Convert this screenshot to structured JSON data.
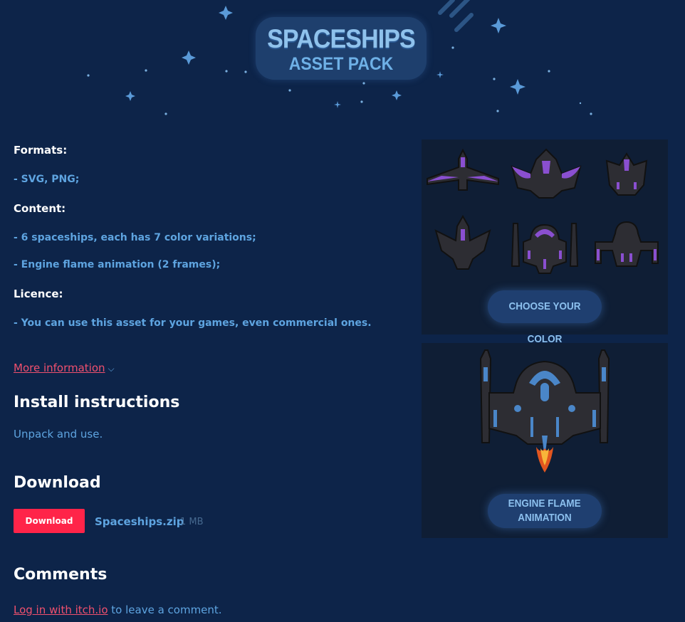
{
  "banner": {
    "line1": "SPACESHIPS",
    "line2": "ASSET PACK"
  },
  "description": {
    "formats_heading": "Formats:",
    "formats_line": "- SVG, PNG;",
    "content_heading": "Content:",
    "content_line1": "- 6 spaceships, each has 7 color variations;",
    "content_line2": "- Engine flame animation (2 frames);",
    "licence_heading": "Licence:",
    "licence_line": "- You can use this asset for your games, even commercial ones."
  },
  "more_info": {
    "label": "More information",
    "icon": "chevron-down-icon"
  },
  "install": {
    "heading": "Install instructions",
    "text": "Unpack and use."
  },
  "download": {
    "heading": "Download",
    "button_label": "Download",
    "file_name": "Spaceships.zip",
    "file_size": "1 MB"
  },
  "comments": {
    "heading": "Comments",
    "login_link": "Log in with itch.io",
    "login_suffix": " to leave a comment."
  },
  "screenshots": {
    "color_label": "CHOOSE YOUR COLOR",
    "flame_label_1": "ENGINE FLAME",
    "flame_label_2": "ANIMATION"
  },
  "colors": {
    "background": "#0d2449",
    "accent_link": "#f0506e",
    "button": "#ff2449",
    "text": "#5ea4e0",
    "ship_purple": "#8a4fd0",
    "ship_blue": "#4a86c8"
  }
}
